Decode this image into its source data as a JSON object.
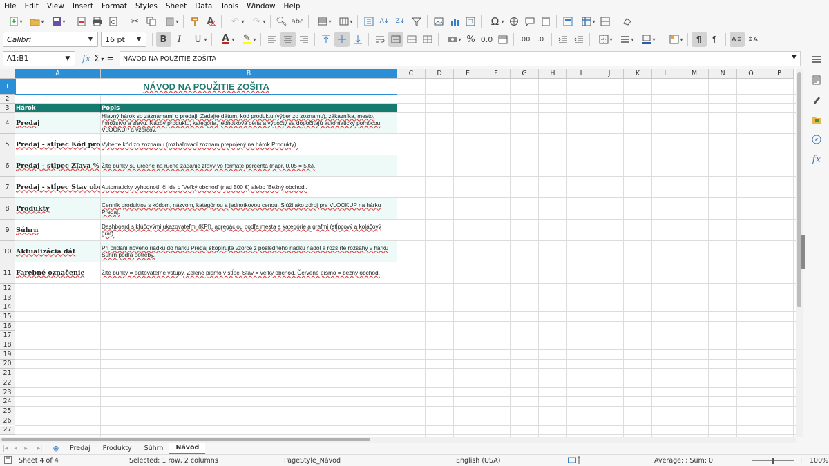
{
  "menu": [
    "File",
    "Edit",
    "View",
    "Insert",
    "Format",
    "Styles",
    "Sheet",
    "Data",
    "Tools",
    "Window",
    "Help"
  ],
  "toolbar": {
    "font_name": "Calibri",
    "font_size": "16 pt"
  },
  "formula_bar": {
    "name_box": "A1:B1",
    "sum_symbol": "Σ",
    "equals_symbol": "=",
    "content": "NÁVOD NA POUŽITIE ZOŠITA"
  },
  "columns": [
    "A",
    "B",
    "C",
    "D",
    "E",
    "F",
    "G",
    "H",
    "I",
    "J",
    "K",
    "L",
    "M",
    "N",
    "O",
    "P"
  ],
  "sheet": {
    "title": "NÁVOD NA POUŽITIE ZOŠITA",
    "header": {
      "col_a": "Hárok",
      "col_b": "Popis"
    },
    "rows": [
      {
        "name": "Predaj",
        "desc": "Hlavný hárok so záznamami o predaji. Zadajte dátum, kód produktu (výber zo zoznamu), zákazníka, mesto, množstvo a zľavu. Názov produktu, kategória, jednotková cena a výpočty sa dopočítajú automaticky pomocou VLOOKUP a vzorcov."
      },
      {
        "name": "Predaj - stĺpec Kód produktu",
        "desc": "Vyberte kód zo zoznamu (rozbaľovací zoznam prepojený na hárok Produkty)."
      },
      {
        "name": "Predaj - stĺpec Zľava %",
        "desc": "Žlté bunky sú určené na ručné zadanie zľavy vo formáte percenta (napr. 0,05 = 5%)."
      },
      {
        "name": "Predaj - stĺpec Stav obchodu",
        "desc": "Automaticky vyhodnotí, či ide o 'Veľký obchod' (nad 500 €) alebo 'Bežný obchod'."
      },
      {
        "name": "Produkty",
        "desc": "Cenník produktov s kódom, názvom, kategóriou a jednotkovou cenou. Slúži ako zdroj pre VLOOKUP na hárku Predaj."
      },
      {
        "name": "Súhrn",
        "desc": "Dashboard s kľúčovými ukazovateľmi (KPI), agregáciou podľa mesta a kategórie a grafmi (stĺpcový a koláčový graf)."
      },
      {
        "name": "Aktualizácia dát",
        "desc": "Pri pridaní nového riadku do hárku Predaj skopírujte vzorce z posledného riadku nadol a rozšírte rozsahy v hárku Súhrn podľa potreby."
      },
      {
        "name": "Farebné označenie",
        "desc": "Žlté bunky = editovateľné vstupy. Zelené písmo v stĺpci Stav = veľký obchod. Červené písmo = bežný obchod."
      }
    ]
  },
  "row_numbers": [
    "1",
    "2",
    "3",
    "4",
    "5",
    "6",
    "7",
    "8",
    "9",
    "10",
    "11",
    "12",
    "13",
    "14",
    "15",
    "16",
    "17",
    "18",
    "19",
    "20",
    "21",
    "22",
    "23",
    "24",
    "25",
    "26",
    "27"
  ],
  "tabs": [
    "Predaj",
    "Produkty",
    "Súhrn",
    "Návod"
  ],
  "status": {
    "sheet": "Sheet 4 of 4",
    "selection": "Selected: 1 row, 2 columns",
    "page_style": "PageStyle_Návod",
    "language": "English (USA)",
    "sum": "Average: ; Sum: 0",
    "zoom": "100%"
  },
  "colors": {
    "teal": "#167a6e",
    "title": "#1e7a70",
    "band": "#eefaf8",
    "selection": "#2a8fd6"
  }
}
